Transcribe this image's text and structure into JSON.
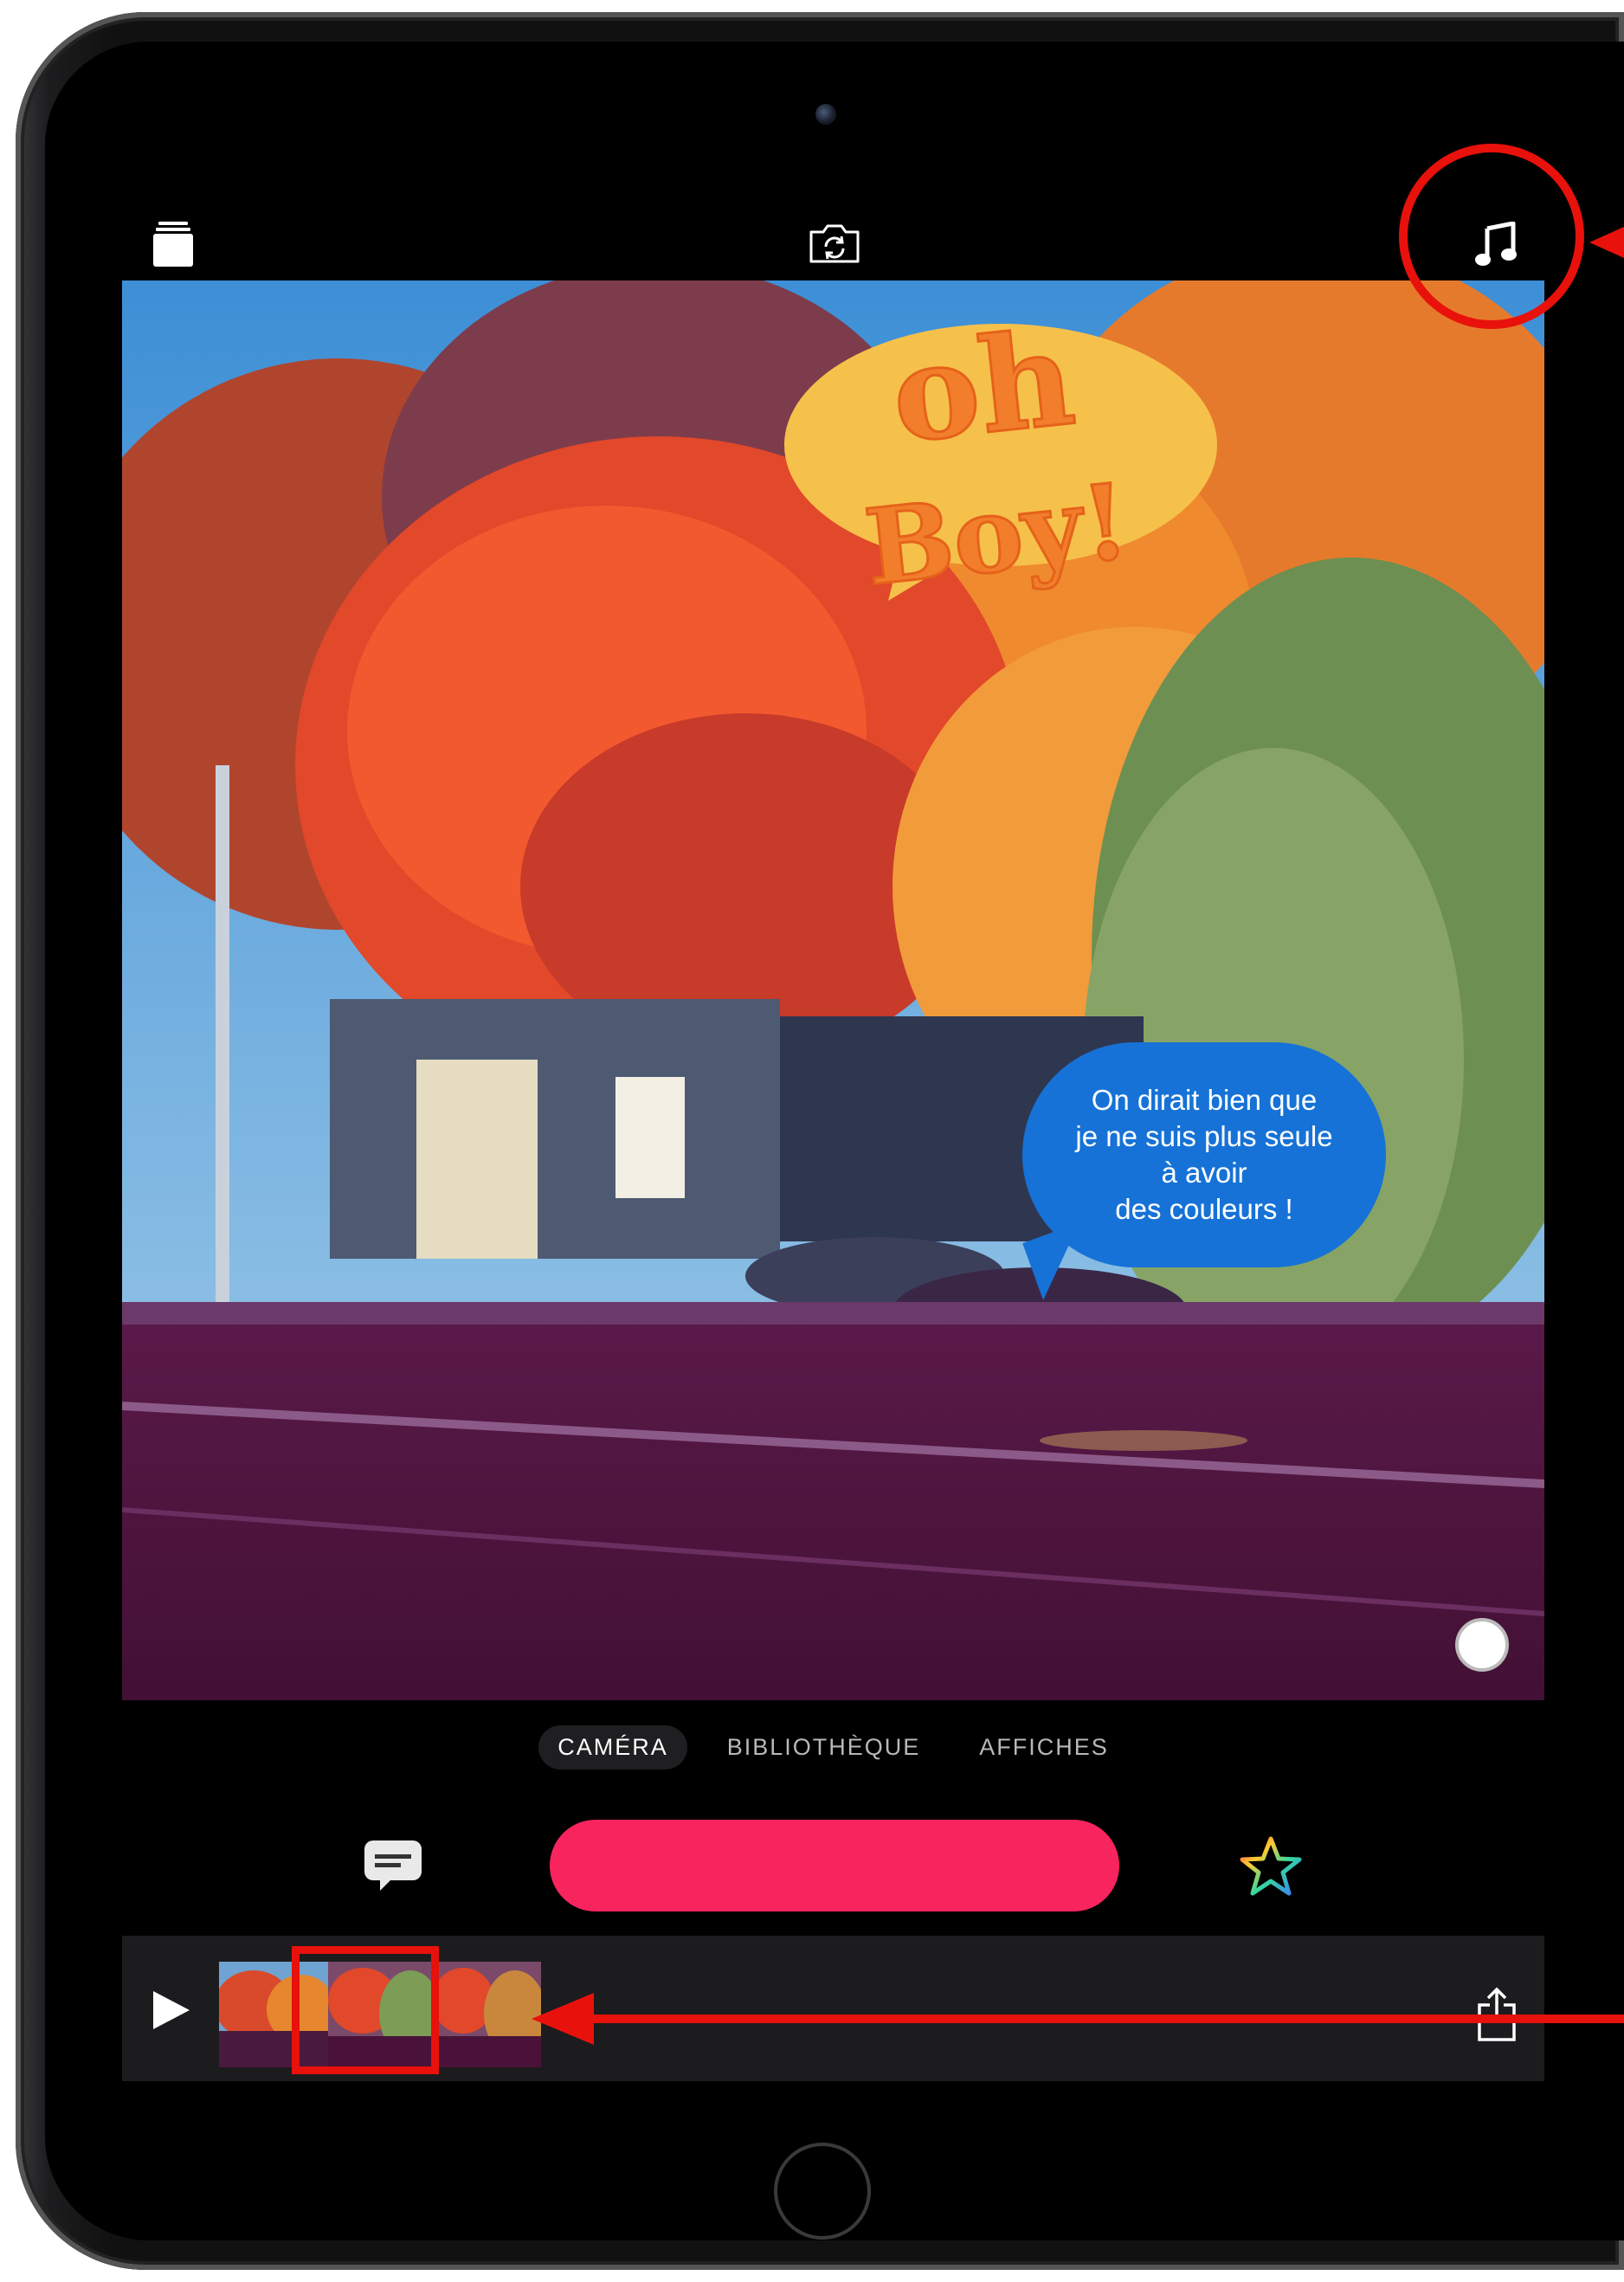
{
  "stickers": {
    "oh_boy_line1": "oh",
    "oh_boy_line2": "Boy!",
    "bubble_line1": "On dirait bien que",
    "bubble_line2": "je ne suis plus seule",
    "bubble_line3": "à avoir",
    "bubble_line4": "des couleurs !"
  },
  "modes": {
    "camera": "CAMÉRA",
    "library": "BIBLIOTHÈQUE",
    "posters": "AFFICHES",
    "selected": "CAMÉRA"
  },
  "top_bar": {
    "left_icon": "clips-stack-icon",
    "center_icon": "switch-camera-icon",
    "right_icon": "music-note-icon"
  },
  "timeline": {
    "clip_count": 3,
    "highlighted_clip": 2
  },
  "colors": {
    "record": "#f7245e",
    "annotation": "#e8110b",
    "bubble_blue": "#1672d6"
  }
}
